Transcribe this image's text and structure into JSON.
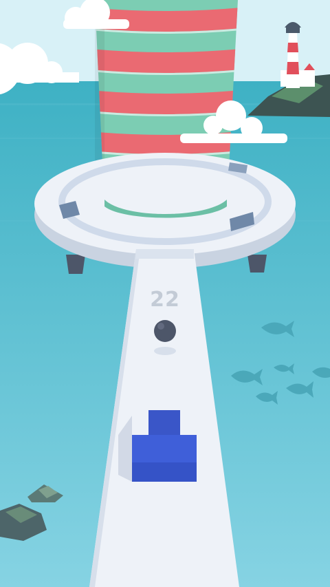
{
  "game": {
    "score": "22"
  },
  "colors": {
    "sky": "#d8f1f7",
    "sea_top": "#3fb3c6",
    "sea_bottom": "#7fd0e2",
    "tower_red": "#ea6a72",
    "tower_green": "#7ccdb3",
    "platform": "#e8edf4",
    "path": "#eef2f8",
    "ball": "#4d5669",
    "block": "#3f5fd9",
    "fish": "#4aa3b4",
    "rock": "#4d6569"
  },
  "scene_elements": [
    "cloud",
    "lighthouse",
    "island",
    "tower",
    "platform",
    "path",
    "ball",
    "block",
    "fish",
    "rocks"
  ]
}
